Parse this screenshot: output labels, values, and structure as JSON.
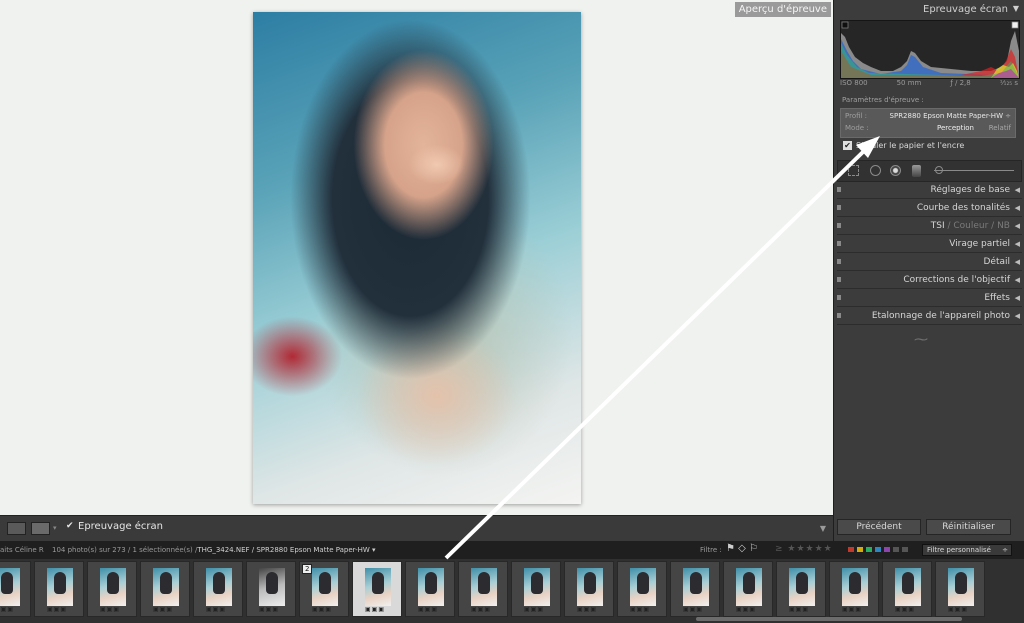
{
  "viewer": {
    "preview_label": "Aperçu d'épreuve"
  },
  "toolbar": {
    "softproof_checkbox": "✔",
    "softproof_label": "Epreuvage écran"
  },
  "panel": {
    "title": "Epreuvage écran",
    "histogram": {
      "iso": "ISO 800",
      "focal": "50 mm",
      "aperture": "ƒ / 2,8",
      "shutter": "¹⁄₁₂₅ s"
    },
    "params_label": "Paramètres d'épreuve :",
    "profile_label": "Profil :",
    "profile_value": "SPR2880 Epson Matte Paper-HW",
    "mode_label": "Mode :",
    "mode_perception": "Perception",
    "mode_relative": "Relatif",
    "paper_label": "Simuler le papier et l'encre",
    "sections": [
      {
        "label": "Réglages de base"
      },
      {
        "label": "Courbe des tonalités"
      },
      {
        "label_main": "TSI",
        "label_b": "Couleur",
        "label_c": "NB"
      },
      {
        "label": "Virage partiel"
      },
      {
        "label": "Détail"
      },
      {
        "label": "Corrections de l'objectif"
      },
      {
        "label": "Effets"
      },
      {
        "label": "Etalonnage de l'appareil photo"
      }
    ],
    "prev_button": "Précédent",
    "reset_button": "Réinitialiser"
  },
  "info_bar": {
    "collection": "aits Céline R",
    "count_text": "104 photo(s) sur 273 / 1 sélectionnée(s) /",
    "file_text": "THG_3424.NEF / SPR2880 Epson Matte Paper-HW ▾",
    "filter_label": "Filtre :",
    "stars": "≥ ★★★★★",
    "filter_select": "Filtre personnalisé"
  },
  "filmstrip": {
    "badge": "2",
    "selected_index": 7,
    "thumbs": [
      {
        "bw": false
      },
      {
        "bw": false
      },
      {
        "bw": false
      },
      {
        "bw": false
      },
      {
        "bw": false
      },
      {
        "bw": true
      },
      {
        "bw": false
      },
      {
        "bw": false
      },
      {
        "bw": false
      },
      {
        "bw": false
      },
      {
        "bw": false
      },
      {
        "bw": false
      },
      {
        "bw": false
      },
      {
        "bw": false
      },
      {
        "bw": false
      },
      {
        "bw": false
      },
      {
        "bw": false
      },
      {
        "bw": false
      },
      {
        "bw": false
      }
    ]
  },
  "colors": {
    "accent_arrow": "#ffffff",
    "label_red": "#c0392b",
    "label_yellow": "#d4ac0d",
    "label_green": "#27ae60",
    "label_blue": "#2e86c1",
    "label_purple": "#8e44ad"
  }
}
